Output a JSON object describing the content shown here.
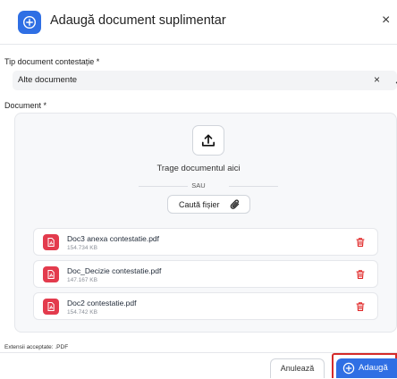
{
  "dialog": {
    "title": "Adaugă document suplimentar",
    "close_label": "×"
  },
  "type_field": {
    "label": "Tip document contestație *",
    "value": "Alte documente",
    "clear_label": "×"
  },
  "document_field": {
    "label": "Document *",
    "drag_text": "Trage documentul aici",
    "or_text": "SAU",
    "browse_label": "Caută fișier"
  },
  "files": [
    {
      "name": "Doc3 anexa contestatie.pdf",
      "size": "154.734 KB"
    },
    {
      "name": "Doc_Decizie contestatie.pdf",
      "size": "147.167 KB"
    },
    {
      "name": "Doc2 contestatie.pdf",
      "size": "154.742 KB"
    }
  ],
  "accepted_extensions": "Extensii acceptate: .PDF",
  "footer": {
    "cancel_label": "Anulează",
    "add_label": "Adaugă"
  },
  "colors": {
    "primary": "#2f6fe4",
    "file_icon": "#e33b4d",
    "delete_icon": "#e02424",
    "highlight_border": "#d42a2a"
  },
  "icons": {
    "header": "plus-circle-icon",
    "upload": "upload-icon",
    "browse": "paperclip-icon",
    "file": "pdf-icon",
    "delete": "trash-icon",
    "add": "plus-circle-icon"
  }
}
